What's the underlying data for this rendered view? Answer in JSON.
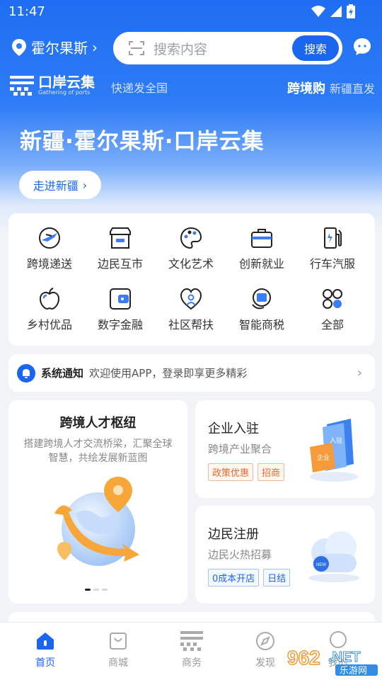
{
  "status_bar": {
    "time": "11:47"
  },
  "header": {
    "location": "霍尔果斯",
    "search_placeholder": "搜索内容",
    "search_button": "搜索"
  },
  "brand": {
    "name": "口岸云集",
    "sub": "Gathering of ports",
    "slogan": "快递发全国",
    "crossbuy": "跨境购",
    "crossbuy_sub": "新疆直发"
  },
  "hero": {
    "title": "新疆·霍尔果斯·口岸云集",
    "button": "走进新疆"
  },
  "services": [
    {
      "label": "跨境递送",
      "icon": "plane-icon"
    },
    {
      "label": "边民互市",
      "icon": "shop-icon"
    },
    {
      "label": "文化艺术",
      "icon": "palette-icon"
    },
    {
      "label": "创新就业",
      "icon": "briefcase-icon"
    },
    {
      "label": "行车汽服",
      "icon": "fuel-icon"
    },
    {
      "label": "乡村优品",
      "icon": "apple-icon"
    },
    {
      "label": "数字金融",
      "icon": "wallet-icon"
    },
    {
      "label": "社区帮扶",
      "icon": "heart-person-icon"
    },
    {
      "label": "智能商税",
      "icon": "tax-icon"
    },
    {
      "label": "全部",
      "icon": "grid-icon"
    }
  ],
  "notice": {
    "title": "系统通知",
    "text": "欢迎使用APP，登录即享更多精彩"
  },
  "talent": {
    "title": "跨境人才枢纽",
    "desc": "搭建跨境人才交流桥梁，汇聚全球智慧，共绘发展新蓝图"
  },
  "enterprise": {
    "title": "企业入驻",
    "desc": "跨境产业聚合",
    "tags": [
      "政策优惠",
      "招商"
    ],
    "art_labels": [
      "入驻",
      "企业"
    ]
  },
  "border": {
    "title": "边民注册",
    "desc": "边民火热招募",
    "tags": [
      "0成本开店",
      "日结"
    ],
    "art_label": "NEW"
  },
  "tabs": [
    {
      "label": "首页",
      "icon": "home-icon"
    },
    {
      "label": "商城",
      "icon": "bag-icon"
    },
    {
      "label": "商务",
      "icon": "business-icon"
    },
    {
      "label": "发现",
      "icon": "compass-icon"
    },
    {
      "label": "我的",
      "icon": "user-icon"
    }
  ],
  "watermark": {
    "number": "962",
    "suffix": ".NET",
    "sub": "乐游网"
  },
  "colors": {
    "primary": "#1a66ee",
    "orange": "#e9692c"
  }
}
